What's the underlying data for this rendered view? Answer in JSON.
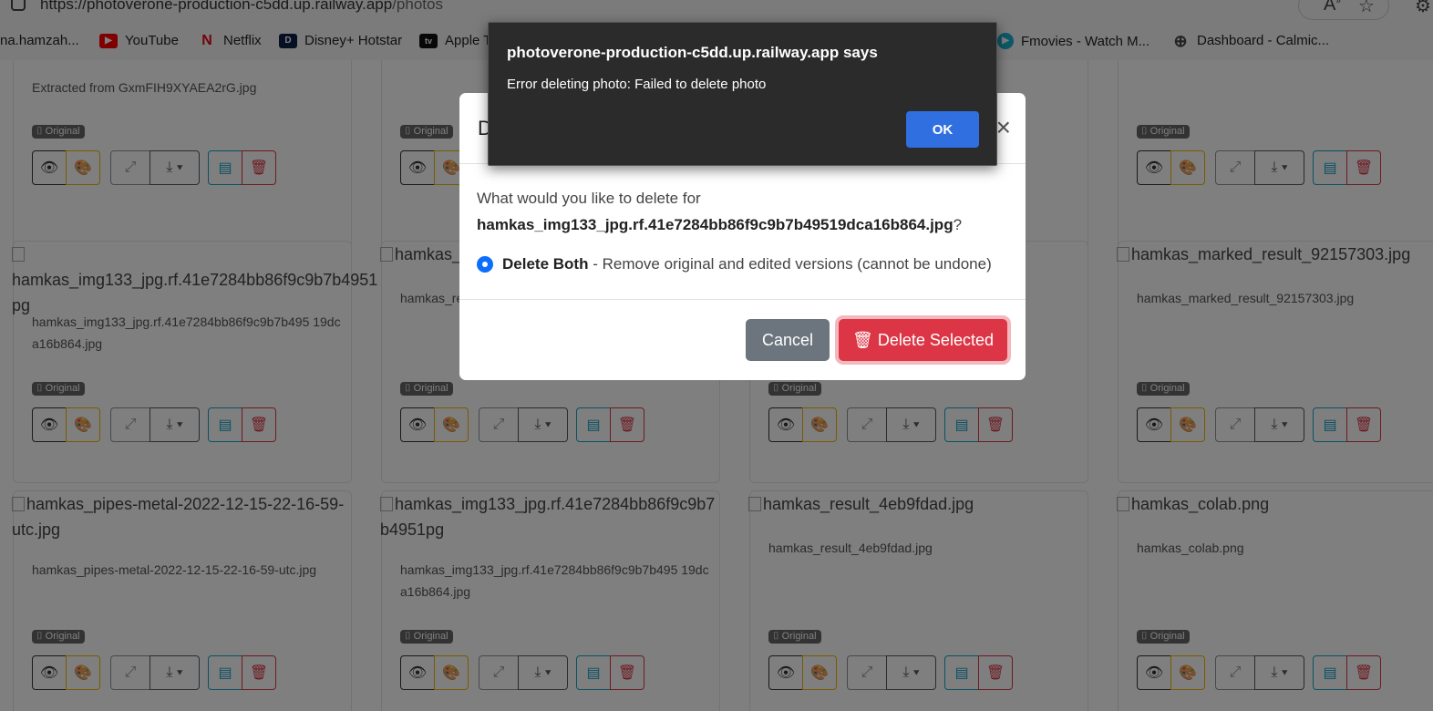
{
  "browser": {
    "url_domain": "https://photoverone-production-c5dd.up.railway.app",
    "url_path": "/photos",
    "bookmarks": [
      {
        "label": "na.hamzah...",
        "logo": "",
        "color": "#777777"
      },
      {
        "label": "YouTube",
        "logo": "▶",
        "color": "#ff0000"
      },
      {
        "label": "Netflix",
        "logo": "N",
        "color": "#e50914"
      },
      {
        "label": "Disney+ Hotstar",
        "logo": "D",
        "color": "#0f1e4a"
      },
      {
        "label": "Apple T",
        "logo": "tv",
        "color": "#111111"
      },
      {
        "label": "Fmovies - Watch M...",
        "logo": "▶",
        "color": "#1ab2d1"
      },
      {
        "label": "Dashboard - Calmic...",
        "logo": "⊕",
        "color": "#444444"
      }
    ]
  },
  "gallery": {
    "badge_label": "Original",
    "cards": [
      {
        "title": "Extracted from GxmFIH9XYAEA2rG.jpg",
        "alt": ""
      },
      {
        "title": "",
        "alt": ""
      },
      {
        "title": "",
        "alt": ""
      },
      {
        "title": "",
        "alt": ""
      },
      {
        "title": "hamkas_img133_jpg.rf.41e7284bb86f9c9b7b495 19dca16b864.jpg",
        "alt": "hamkas_img133_jpg.rf.41e7284bb86f9c9b7b4951​pg"
      },
      {
        "title": "hamkas_re",
        "alt": "hamkas_"
      },
      {
        "title": "",
        "alt": ""
      },
      {
        "title": "hamkas_marked_result_92157303.jpg",
        "alt": "hamkas_marked_result_92157303.jpg"
      },
      {
        "title": "hamkas_pipes-metal-2022-12-15-22-16-59-utc.jpg",
        "alt": "hamkas_pipes-metal-2022-12-15-22-16-59-utc.jpg"
      },
      {
        "title": "hamkas_img133_jpg.rf.41e7284bb86f9c9b7b495 19dca16b864.jpg",
        "alt": "hamkas_img133_jpg.rf.41e7284bb86f9c9b7b4951​pg"
      },
      {
        "title": "hamkas_result_4eb9fdad.jpg",
        "alt": "hamkas_result_4eb9fdad.jpg"
      },
      {
        "title": "hamkas_colab.png",
        "alt": "hamkas_colab.png"
      }
    ]
  },
  "modal": {
    "title_partial": "D",
    "close_glyph": "×",
    "question_prefix": "What would you like to delete for",
    "filename": "hamkas_img133_jpg.rf.41e7284bb86f9c9b7b49519dca16b864.jpg",
    "question_suffix": "?",
    "option_label": "Delete Both",
    "option_desc": "- Remove original and edited versions (cannot be undone)",
    "cancel_label": "Cancel",
    "delete_label": "Delete Selected"
  },
  "alert": {
    "title": "photoverone-production-c5dd.up.railway.app says",
    "message": "Error deleting photo: Failed to delete photo",
    "ok_label": "OK"
  }
}
